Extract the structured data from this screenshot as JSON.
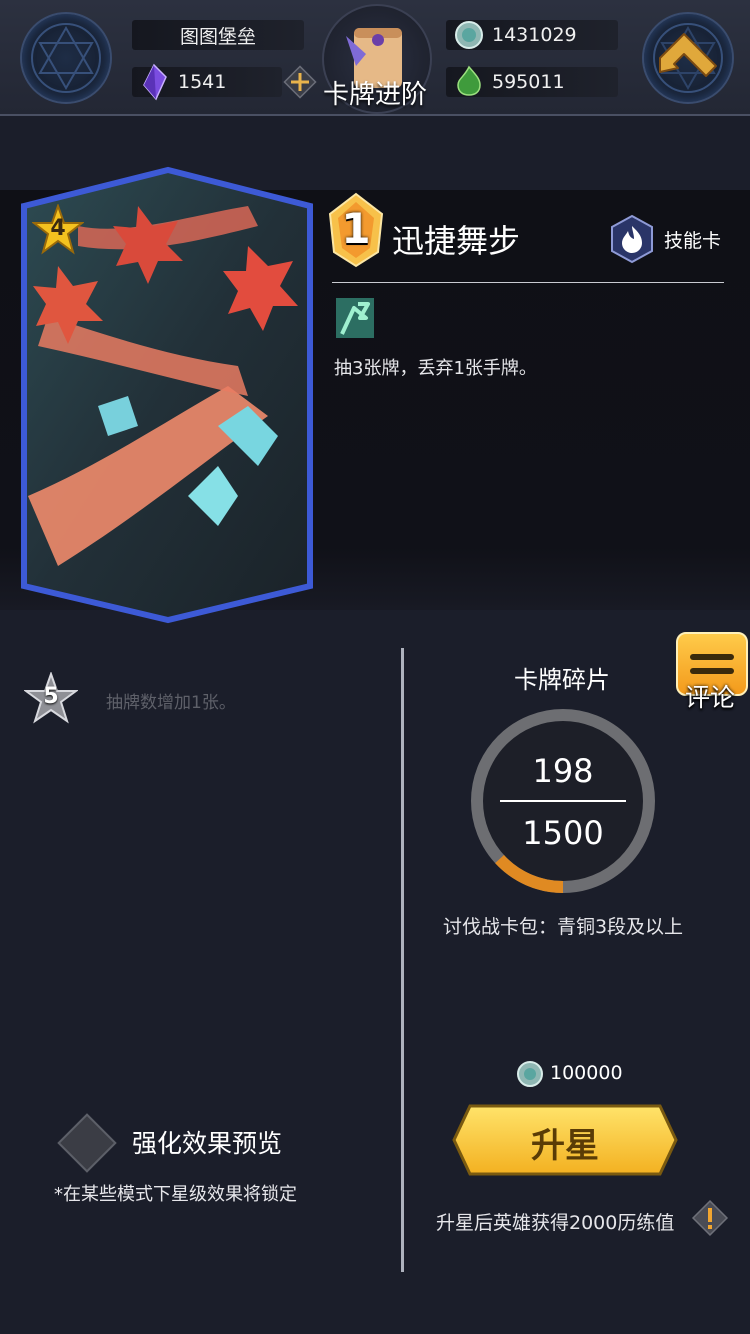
{
  "header": {
    "player_name": "图图堡垒",
    "gems": "1541",
    "coins": "1431029",
    "emerald": "595011",
    "page_title": "卡牌进阶"
  },
  "card": {
    "cost": "1",
    "star_level": "4",
    "name": "迅捷舞步",
    "type_label": "技能卡",
    "description": "抽3张牌，丢弃1张手牌。"
  },
  "star_bonus": {
    "level": "5",
    "text": "抽牌数增加1张。"
  },
  "preview": {
    "label": "强化效果预览",
    "note": "*在某些模式下星级效果将锁定"
  },
  "fragments": {
    "title": "卡牌碎片",
    "current": "198",
    "required": "1500",
    "progress": 0.132,
    "source": "讨伐战卡包：青铜3段及以上"
  },
  "comment_button": {
    "label": "评论"
  },
  "upgrade": {
    "cost": "100000",
    "button_label": "升星",
    "reward_text": "升星后英雄获得2000历练值"
  },
  "colors": {
    "accent_gold": "#f2b531",
    "progress_orange": "#e08a22",
    "ring_gray": "#6d6e72",
    "frame_blue": "#3d5ad6"
  }
}
